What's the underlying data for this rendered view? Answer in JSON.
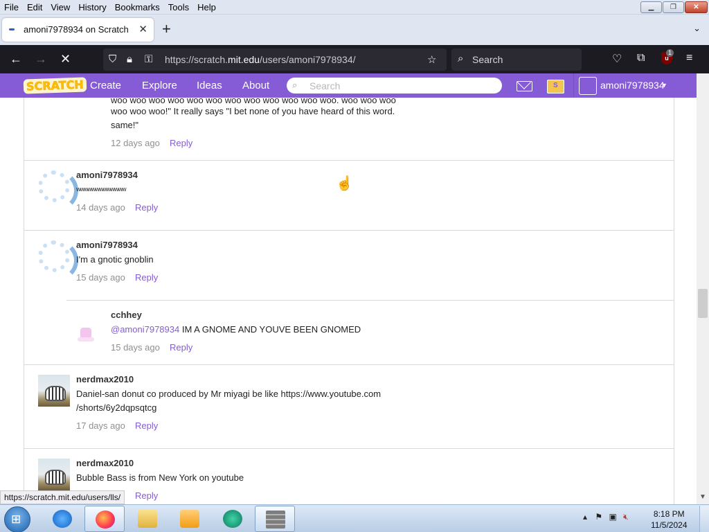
{
  "browser": {
    "menu": [
      "File",
      "Edit",
      "View",
      "History",
      "Bookmarks",
      "Tools",
      "Help"
    ],
    "tab_title": "amoni7978934 on Scratch",
    "url_prefix": "https://scratch.",
    "url_domain": "mit.edu",
    "url_path": "/users/amoni7978934/",
    "search_placeholder": "Search",
    "ublock_count": "1",
    "status_link": "https://scratch.mit.edu/users/lls/"
  },
  "scratch_nav": {
    "logo": "SCRATCH",
    "create": "Create",
    "explore": "Explore",
    "ideas": "Ideas",
    "about": "About",
    "search_placeholder": "Search",
    "username": "amoni7978934"
  },
  "comments": [
    {
      "text_lines": [
        "woo woo woo woo woo woo woo woo woo woo woo woo. woo woo woo",
        "woo woo woo!\" It really says \"I bet none of you have heard of this word.",
        "same!\""
      ],
      "time": "12 days ago",
      "reply": "Reply"
    },
    {
      "author": "amoni7978934",
      "text": "wwwwwwwwwwwww",
      "time": "14 days ago",
      "reply": "Reply"
    },
    {
      "author": "amoni7978934",
      "text": "I'm a gnotic gnoblin",
      "time": "15 days ago",
      "reply": "Reply"
    },
    {
      "author": "cchhey",
      "mention": "@amoni7978934",
      "text": " IM A GNOME AND YOUVE BEEN GNOMED",
      "time": "15 days ago",
      "reply": "Reply"
    },
    {
      "author": "nerdmax2010",
      "text_lines": [
        "Daniel-san donut co produced by Mr miyagi be like https://www.youtube.com",
        "/shorts/6y2dqpsqtcg"
      ],
      "time": "17 days ago",
      "reply": "Reply"
    },
    {
      "author": "nerdmax2010",
      "text": "Bubble Bass is from New York on youtube",
      "reply": "Reply"
    }
  ],
  "taskbar": {
    "time": "8:18 PM",
    "date": "11/5/2024"
  },
  "colors": {
    "scratch_purple": "#855cd6",
    "firefox_dark": "#1c1b22"
  }
}
